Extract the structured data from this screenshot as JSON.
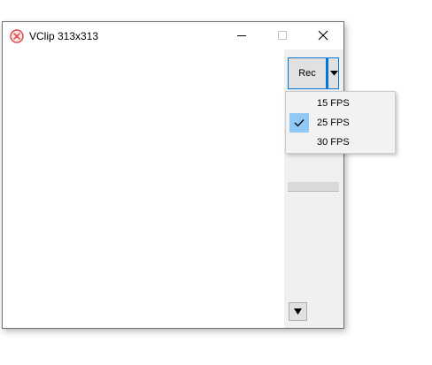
{
  "window": {
    "title": "VClip 313x313",
    "app_icon": "vclip-logo-icon",
    "controls": {
      "minimize_icon": "minimize-icon",
      "maximize_icon": "maximize-icon",
      "close_icon": "close-icon"
    }
  },
  "panel": {
    "rec_label": "Rec",
    "rec_dropdown_icon": "triangle-down-icon",
    "scroll_down_icon": "triangle-down-icon"
  },
  "fps_menu": {
    "items": [
      {
        "label": "15 FPS",
        "checked": false
      },
      {
        "label": "25 FPS",
        "checked": true
      },
      {
        "label": "30 FPS",
        "checked": false
      }
    ],
    "check_icon": "checkmark-icon"
  },
  "colors": {
    "accent": "#0078d7",
    "menu_check_highlight": "#90c8f6",
    "logo_red": "#e0474c"
  }
}
